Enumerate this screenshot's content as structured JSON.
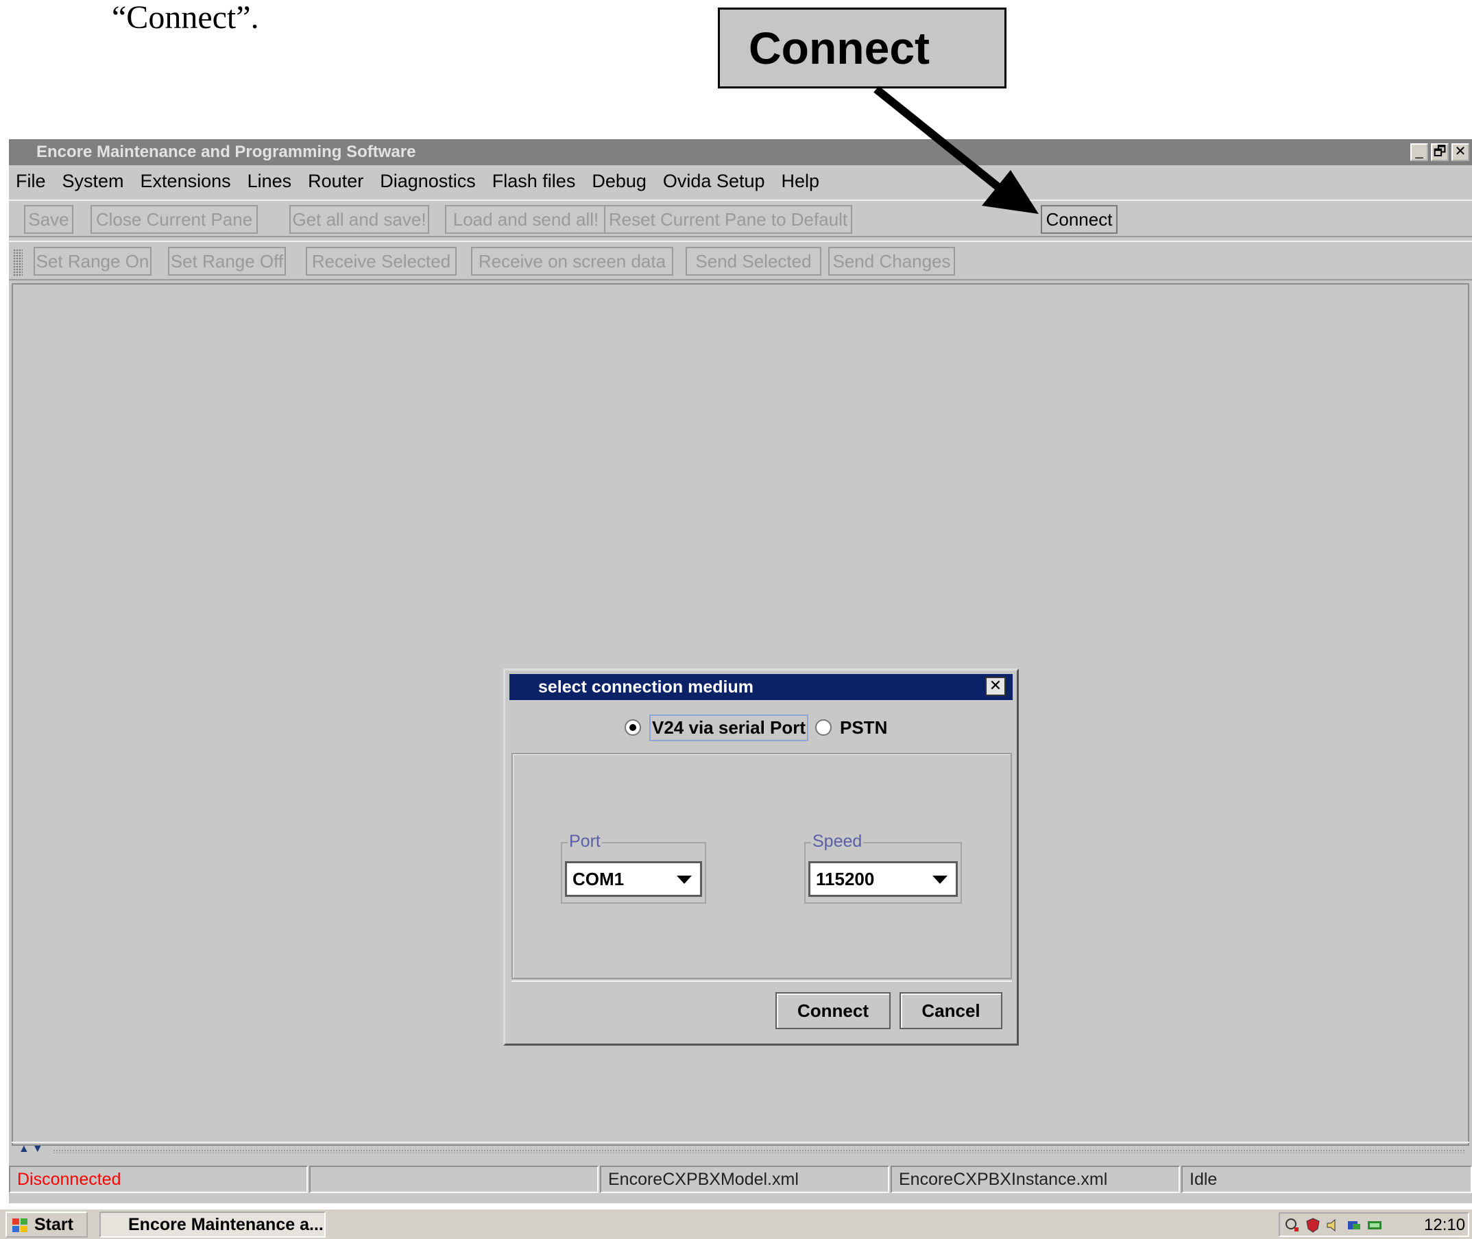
{
  "annotation": {
    "caption": "“Connect”.",
    "callout_label": "Connect"
  },
  "window": {
    "title": "Encore Maintenance and Programming Software",
    "controls": {
      "minimize": "_",
      "restore": "🗗",
      "close": "✕"
    }
  },
  "menu": [
    "File",
    "System",
    "Extensions",
    "Lines",
    "Router",
    "Diagnostics",
    "Flash files",
    "Debug",
    "Ovida Setup",
    "Help"
  ],
  "toolbar1": {
    "save": "Save",
    "close_pane": "Close Current Pane",
    "get_all": "Get all and save!",
    "load_send": "Load and send all!",
    "reset_pane": "Reset Current Pane to Default",
    "connect": "Connect"
  },
  "toolbar2": {
    "range_on": "Set Range On",
    "range_off": "Set Range Off",
    "receive_selected": "Receive Selected",
    "receive_screen": "Receive on screen data",
    "send_selected": "Send Selected",
    "send_changes": "Send Changes"
  },
  "dialog": {
    "title": "select connection medium",
    "close": "✕",
    "options": {
      "v24": "V24 via serial Port",
      "pstn": "PSTN",
      "selected": "V24 via serial Port"
    },
    "port": {
      "label": "Port",
      "value": "COM1"
    },
    "speed": {
      "label": "Speed",
      "value": "115200"
    },
    "connect": "Connect",
    "cancel": "Cancel"
  },
  "status": {
    "connection": "Disconnected",
    "progress": "",
    "model_file": "EncoreCXPBXModel.xml",
    "instance_file": "EncoreCXPBXInstance.xml",
    "state": "Idle"
  },
  "colors": {
    "status_disconnected": "#ff0000",
    "dialog_title_bg": "#0b2266",
    "window_title_bg": "#808080"
  },
  "taskbar": {
    "start": "Start",
    "task": "Encore Maintenance a...",
    "clock": "12:10"
  }
}
